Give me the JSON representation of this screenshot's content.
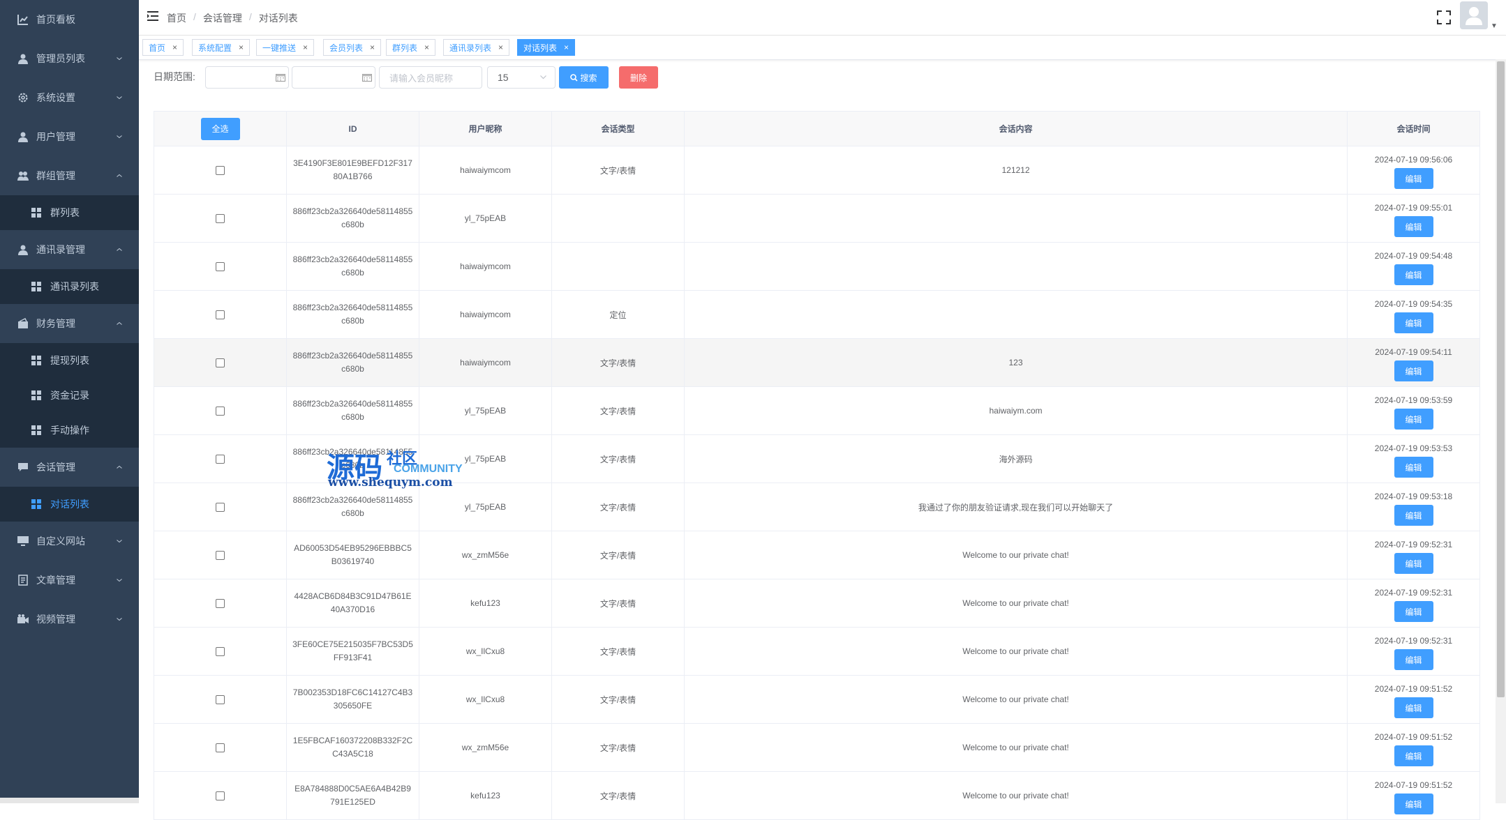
{
  "sidebar": {
    "items": [
      {
        "label": "首页看板",
        "icon": "dashboard-icon",
        "arrow": ""
      },
      {
        "label": "管理员列表",
        "icon": "user-icon",
        "arrow": "down"
      },
      {
        "label": "系统设置",
        "icon": "gear-icon",
        "arrow": "down"
      },
      {
        "label": "用户管理",
        "icon": "user-icon",
        "arrow": "down"
      },
      {
        "label": "群组管理",
        "icon": "group-icon",
        "arrow": "up"
      },
      {
        "label": "通讯录管理",
        "icon": "user-icon",
        "arrow": "up"
      },
      {
        "label": "财务管理",
        "icon": "wallet-icon",
        "arrow": "up"
      },
      {
        "label": "会话管理",
        "icon": "chat-icon",
        "arrow": "up"
      },
      {
        "label": "自定义网站",
        "icon": "monitor-icon",
        "arrow": "down"
      },
      {
        "label": "文章管理",
        "icon": "document-icon",
        "arrow": "down"
      },
      {
        "label": "视频管理",
        "icon": "video-icon",
        "arrow": "down"
      }
    ],
    "subitems": {
      "group_list": "群列表",
      "contacts_list": "通讯录列表",
      "withdraw_list": "提现列表",
      "funds_record": "资金记录",
      "manual_op": "手动操作",
      "dialog_list": "对话列表"
    }
  },
  "breadcrumb": [
    "首页",
    "会话管理",
    "对话列表"
  ],
  "breadcrumb_sep": "/",
  "tags": [
    {
      "label": "首页",
      "active": false
    },
    {
      "label": "系统配置",
      "active": false
    },
    {
      "label": "一键推送",
      "active": false
    },
    {
      "label": "会员列表",
      "active": false
    },
    {
      "label": "群列表",
      "active": false
    },
    {
      "label": "通讯录列表",
      "active": false
    },
    {
      "label": "对话列表",
      "active": true
    }
  ],
  "tag_close": "×",
  "filter": {
    "date_label": "日期范围:",
    "nickname_placeholder": "请输入会员昵称",
    "page_size": "15",
    "search_label": "搜索",
    "delete_label": "删除"
  },
  "table": {
    "select_all": "全选",
    "columns": [
      "ID",
      "用户昵称",
      "会话类型",
      "会话内容",
      "会话时间"
    ],
    "edit_label": "编辑",
    "rows": [
      {
        "id": "3E4190F3E801E9BEFD12F31780A1B766",
        "nick": "haiwaiymcom",
        "type": "文字/表情",
        "content": "121212",
        "time": "2024-07-19 09:56:06"
      },
      {
        "id": "886ff23cb2a326640de58114855c680b",
        "nick": "yl_75pEAB",
        "type": "",
        "content": "",
        "time": "2024-07-19 09:55:01"
      },
      {
        "id": "886ff23cb2a326640de58114855c680b",
        "nick": "haiwaiymcom",
        "type": "",
        "content": "",
        "time": "2024-07-19 09:54:48"
      },
      {
        "id": "886ff23cb2a326640de58114855c680b",
        "nick": "haiwaiymcom",
        "type": "定位",
        "content": "",
        "time": "2024-07-19 09:54:35"
      },
      {
        "id": "886ff23cb2a326640de58114855c680b",
        "nick": "haiwaiymcom",
        "type": "文字/表情",
        "content": "123",
        "time": "2024-07-19 09:54:11"
      },
      {
        "id": "886ff23cb2a326640de58114855c680b",
        "nick": "yl_75pEAB",
        "type": "文字/表情",
        "content": "haiwaiym.com",
        "time": "2024-07-19 09:53:59"
      },
      {
        "id": "886ff23cb2a326640de58114855c680b",
        "nick": "yl_75pEAB",
        "type": "文字/表情",
        "content": "海外源码",
        "time": "2024-07-19 09:53:53"
      },
      {
        "id": "886ff23cb2a326640de58114855c680b",
        "nick": "yl_75pEAB",
        "type": "文字/表情",
        "content": "我通过了你的朋友验证请求,现在我们可以开始聊天了",
        "time": "2024-07-19 09:53:18"
      },
      {
        "id": "AD60053D54EB95296EBBBC5B03619740",
        "nick": "wx_zmM56e",
        "type": "文字/表情",
        "content": "Welcome to our private chat!",
        "time": "2024-07-19 09:52:31"
      },
      {
        "id": "4428ACB6D84B3C91D47B61E40A370D16",
        "nick": "kefu123",
        "type": "文字/表情",
        "content": "Welcome to our private chat!",
        "time": "2024-07-19 09:52:31"
      },
      {
        "id": "3FE60CE75E215035F7BC53D5FF913F41",
        "nick": "wx_IlCxu8",
        "type": "文字/表情",
        "content": "Welcome to our private chat!",
        "time": "2024-07-19 09:52:31"
      },
      {
        "id": "7B002353D18FC6C14127C4B3305650FE",
        "nick": "wx_IlCxu8",
        "type": "文字/表情",
        "content": "Welcome to our private chat!",
        "time": "2024-07-19 09:51:52"
      },
      {
        "id": "1E5FBCAF160372208B332F2CC43A5C18",
        "nick": "wx_zmM56e",
        "type": "文字/表情",
        "content": "Welcome to our private chat!",
        "time": "2024-07-19 09:51:52"
      },
      {
        "id": "E8A784888D0C5AE6A4B42B9791E125ED",
        "nick": "kefu123",
        "type": "文字/表情",
        "content": "Welcome to our private chat!",
        "time": "2024-07-19 09:51:52"
      }
    ]
  },
  "watermark": {
    "big": "源码",
    "small": "社区",
    "english": "COMMUNITY",
    "url": "www.shequym.com"
  },
  "colors": {
    "sidebar_bg": "#304156",
    "primary": "#409eff",
    "danger": "#f56c6c"
  }
}
